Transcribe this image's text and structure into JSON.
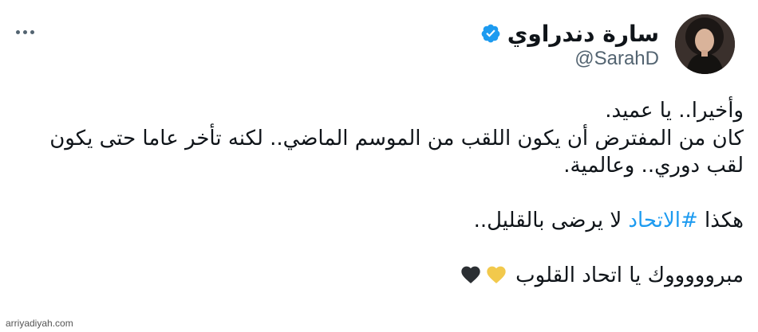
{
  "tweet": {
    "author_name": "سارة دندراوي",
    "handle": "@SarahD",
    "verified": true,
    "lines": [
      "وأخيرا.. يا عميد.",
      "كان من المفترض أن يكون اللقب من الموسم الماضي.. لكنه تأخر عاما حتى يكون",
      "لقب دوري.. وعالمية."
    ],
    "hashtag_line": {
      "prefix": "هكذا ",
      "hashtag": "#الاتحاد",
      "suffix": " لا يرضى بالقليل.."
    },
    "closing_line": "مبروووووك يا اتحاد القلوب",
    "emojis": [
      "yellow-heart",
      "black-heart"
    ]
  },
  "colors": {
    "text": "#0f1419",
    "secondary": "#536471",
    "accent": "#1d9bf0",
    "yellow_heart": "#f2c94c",
    "black_heart": "#2b2f33"
  },
  "icons": [
    "more-options-icon",
    "verified-badge-icon",
    "avatar"
  ],
  "watermark": "arriyadiyah.com"
}
